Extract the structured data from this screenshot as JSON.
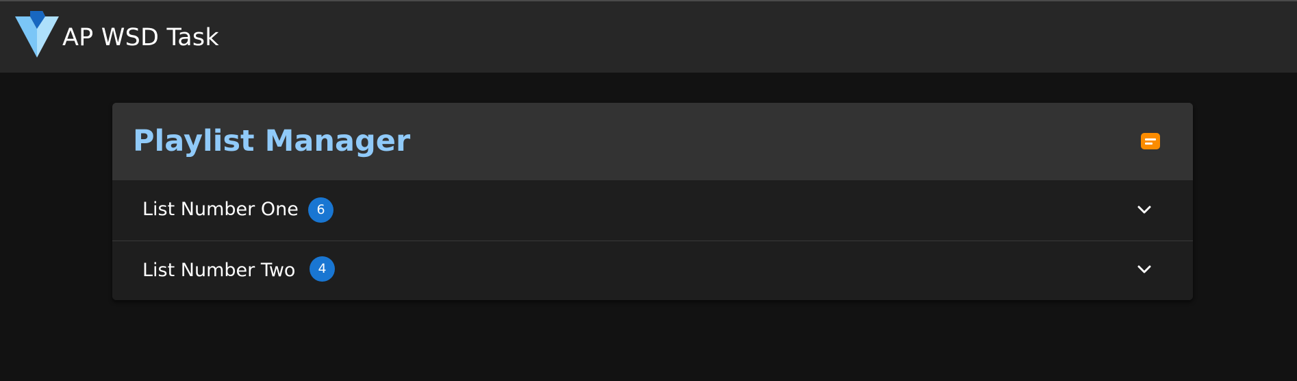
{
  "app_bar": {
    "title": "AP WSD Task",
    "logo_icon": "vuetify-logo-icon"
  },
  "card": {
    "title": "Playlist Manager",
    "header_icon": "message-icon",
    "panels": [
      {
        "label": "List Number One",
        "count": "6",
        "expand_icon": "chevron-down-icon"
      },
      {
        "label": "List Number Two",
        "count": "4",
        "expand_icon": "chevron-down-icon"
      }
    ]
  },
  "colors": {
    "background": "#121212",
    "app_bar": "#272727",
    "card": "#1e1e1e",
    "card_header": "#333333",
    "title_accent": "#90caf9",
    "badge": "#1976d2",
    "header_icon": "#fb8c00"
  }
}
